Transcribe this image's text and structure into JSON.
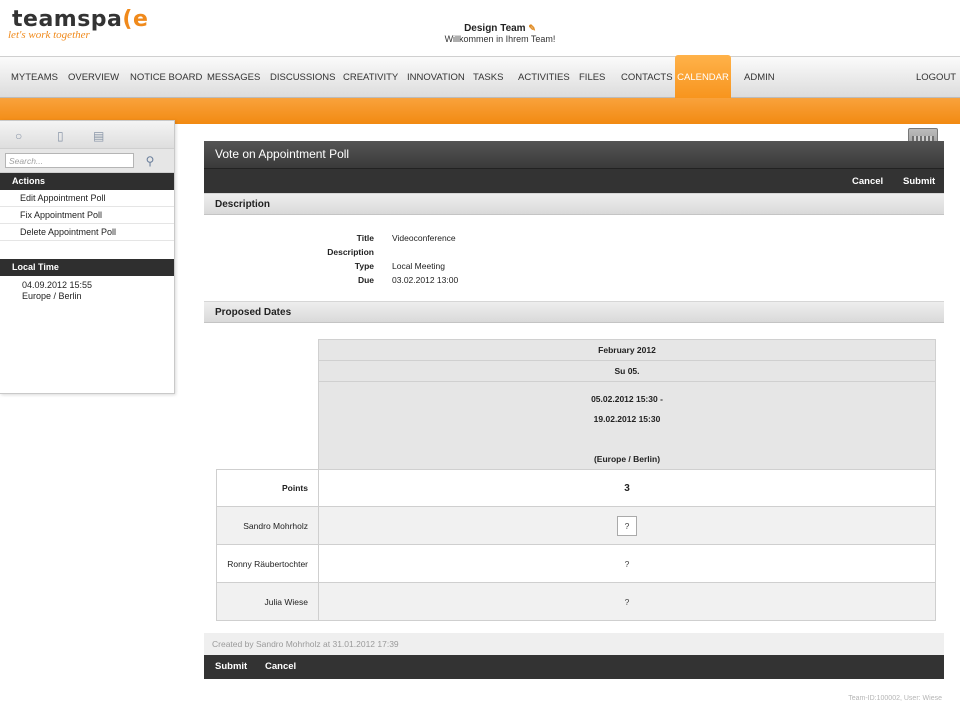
{
  "header": {
    "logo_text_a": "teamspa",
    "logo_text_b": "(e",
    "logo_tagline": "let's work together",
    "team_name": "Design Team",
    "team_welcome": "Willkommen in Ihrem Team!"
  },
  "nav": {
    "items": [
      "MYTEAMS",
      "OVERVIEW",
      "NOTICE BOARD",
      "MESSAGES",
      "DISCUSSIONS",
      "CREATIVITY",
      "INNOVATION",
      "TASKS",
      "ACTIVITIES",
      "FILES",
      "CONTACTS",
      "CALENDAR",
      "ADMIN"
    ],
    "active": "CALENDAR",
    "logout": "LOGOUT"
  },
  "sidebar": {
    "search_placeholder": "Search...",
    "actions_title": "Actions",
    "actions": [
      "Edit Appointment Poll",
      "Fix Appointment Poll",
      "Delete Appointment Poll"
    ],
    "local_time_title": "Local Time",
    "local_time": "04.09.2012 15:55",
    "timezone": "Europe / Berlin"
  },
  "panel": {
    "title": "Vote on Appointment Poll",
    "cancel": "Cancel",
    "submit": "Submit",
    "description_heading": "Description",
    "description": {
      "title_label": "Title",
      "title_value": "Videoconference",
      "description_label": "Description",
      "type_label": "Type",
      "type_value": "Local Meeting",
      "due_label": "Due",
      "due_value": "03.02.2012 13:00"
    },
    "proposed_heading": "Proposed Dates",
    "poll": {
      "month": "February 2012",
      "day": "Su 05.",
      "range_start": "05.02.2012 15:30 -",
      "range_end": "19.02.2012 15:30",
      "timezone": "(Europe / Berlin)",
      "points_label": "Points",
      "points_value": "3",
      "participants": [
        {
          "name": "Sandro Mohrholz",
          "vote": "?"
        },
        {
          "name": "Ronny Räubertochter",
          "vote": "?"
        },
        {
          "name": "Julia Wiese",
          "vote": "?"
        }
      ]
    },
    "created_by": "Created by Sandro Mohrholz at 31.01.2012 17:39",
    "bottom_submit": "Submit",
    "bottom_cancel": "Cancel"
  },
  "footer": {
    "team_id": "Team-ID:100002, User: Wiese"
  }
}
